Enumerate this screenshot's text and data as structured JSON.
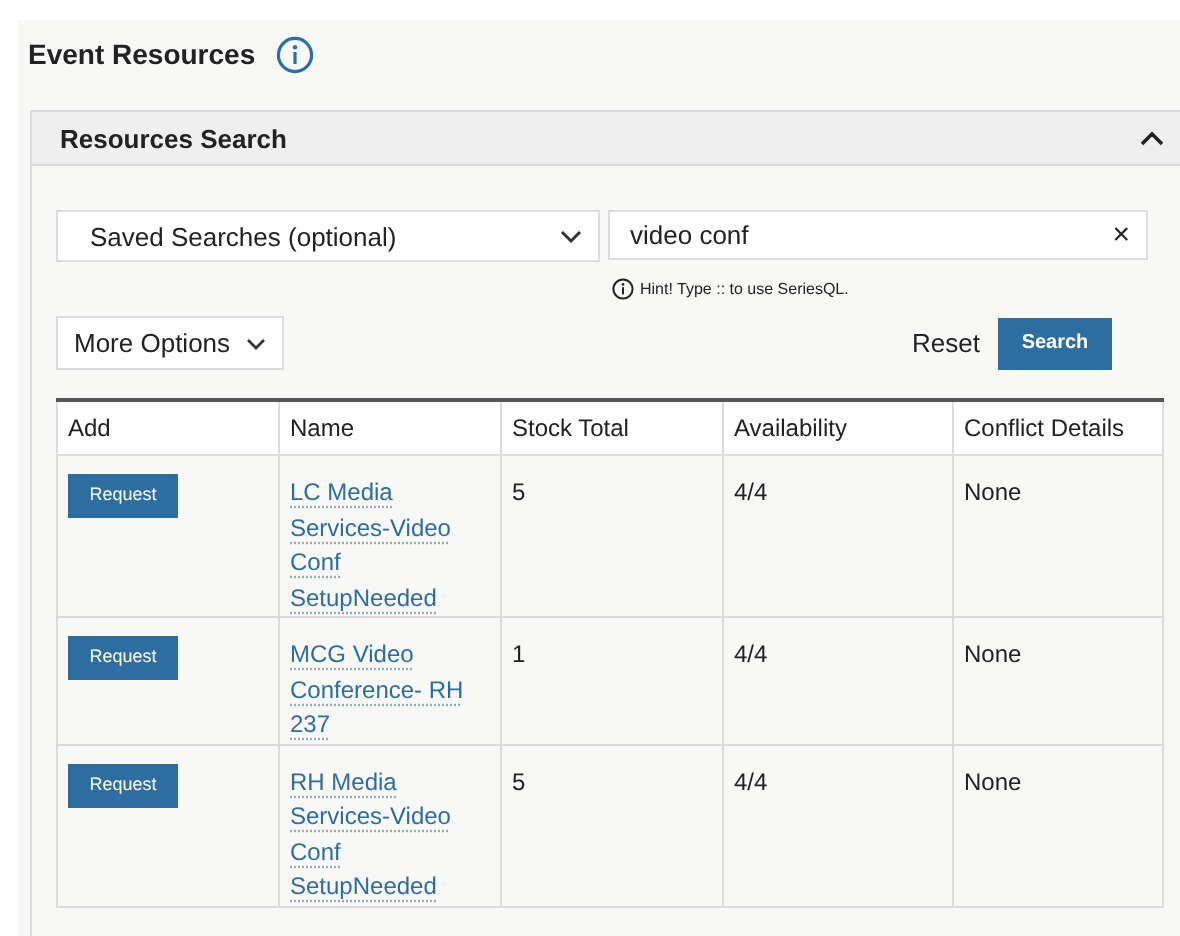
{
  "page": {
    "title": "Event Resources"
  },
  "panel": {
    "title": "Resources Search",
    "expanded": true
  },
  "saved_searches": {
    "placeholder": "Saved Searches (optional)"
  },
  "search_field": {
    "value": "video conf",
    "clear": "×"
  },
  "hint": "Hint! Type :: to use SeriesQL.",
  "more_options": "More Options",
  "reset": "Reset",
  "search_button": "Search",
  "table": {
    "columns": [
      "Add",
      "Name",
      "Stock Total",
      "Availability",
      "Conflict Details"
    ],
    "rows": [
      {
        "action": "Request",
        "name": "LC Media Services-Video Conf SetupNeeded",
        "stock": "5",
        "availability": "4/4",
        "conflict": "None"
      },
      {
        "action": "Request",
        "name": "MCG Video Conference- RH 237",
        "stock": "1",
        "availability": "4/4",
        "conflict": "None"
      },
      {
        "action": "Request",
        "name": "RH Media Services-Video Conf SetupNeeded",
        "stock": "5",
        "availability": "4/4",
        "conflict": "None"
      }
    ]
  }
}
